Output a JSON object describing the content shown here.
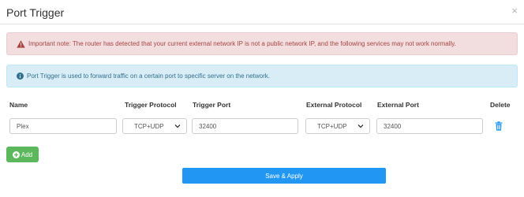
{
  "modal": {
    "title": "Port Trigger",
    "close_symbol": "×"
  },
  "alerts": {
    "warning_text": "Important note: The router has detected that your current external network IP is not a public network IP, and the following services may not work normally.",
    "warning_icon": "warning-triangle-icon",
    "warning_color": "#a94442",
    "info_text": "Port Trigger is used to forward traffic on a certain port to specific server on the network.",
    "info_icon": "info-circle-icon",
    "info_color": "#31708f"
  },
  "table": {
    "headers": {
      "name": "Name",
      "trigger_protocol": "Trigger Protocol",
      "trigger_port": "Trigger Port",
      "external_protocol": "External Protocol",
      "external_port": "External Port",
      "delete": "Delete"
    },
    "rows": [
      {
        "name": "Plex",
        "trigger_protocol": "TCP+UDP",
        "trigger_port": "32400",
        "external_protocol": "TCP+UDP",
        "external_port": "32400",
        "delete_icon": "trash-icon"
      }
    ]
  },
  "buttons": {
    "add_label": "Add",
    "add_color": "#5cb85c",
    "save_label": "Save & Apply",
    "save_color": "#2196f3"
  }
}
